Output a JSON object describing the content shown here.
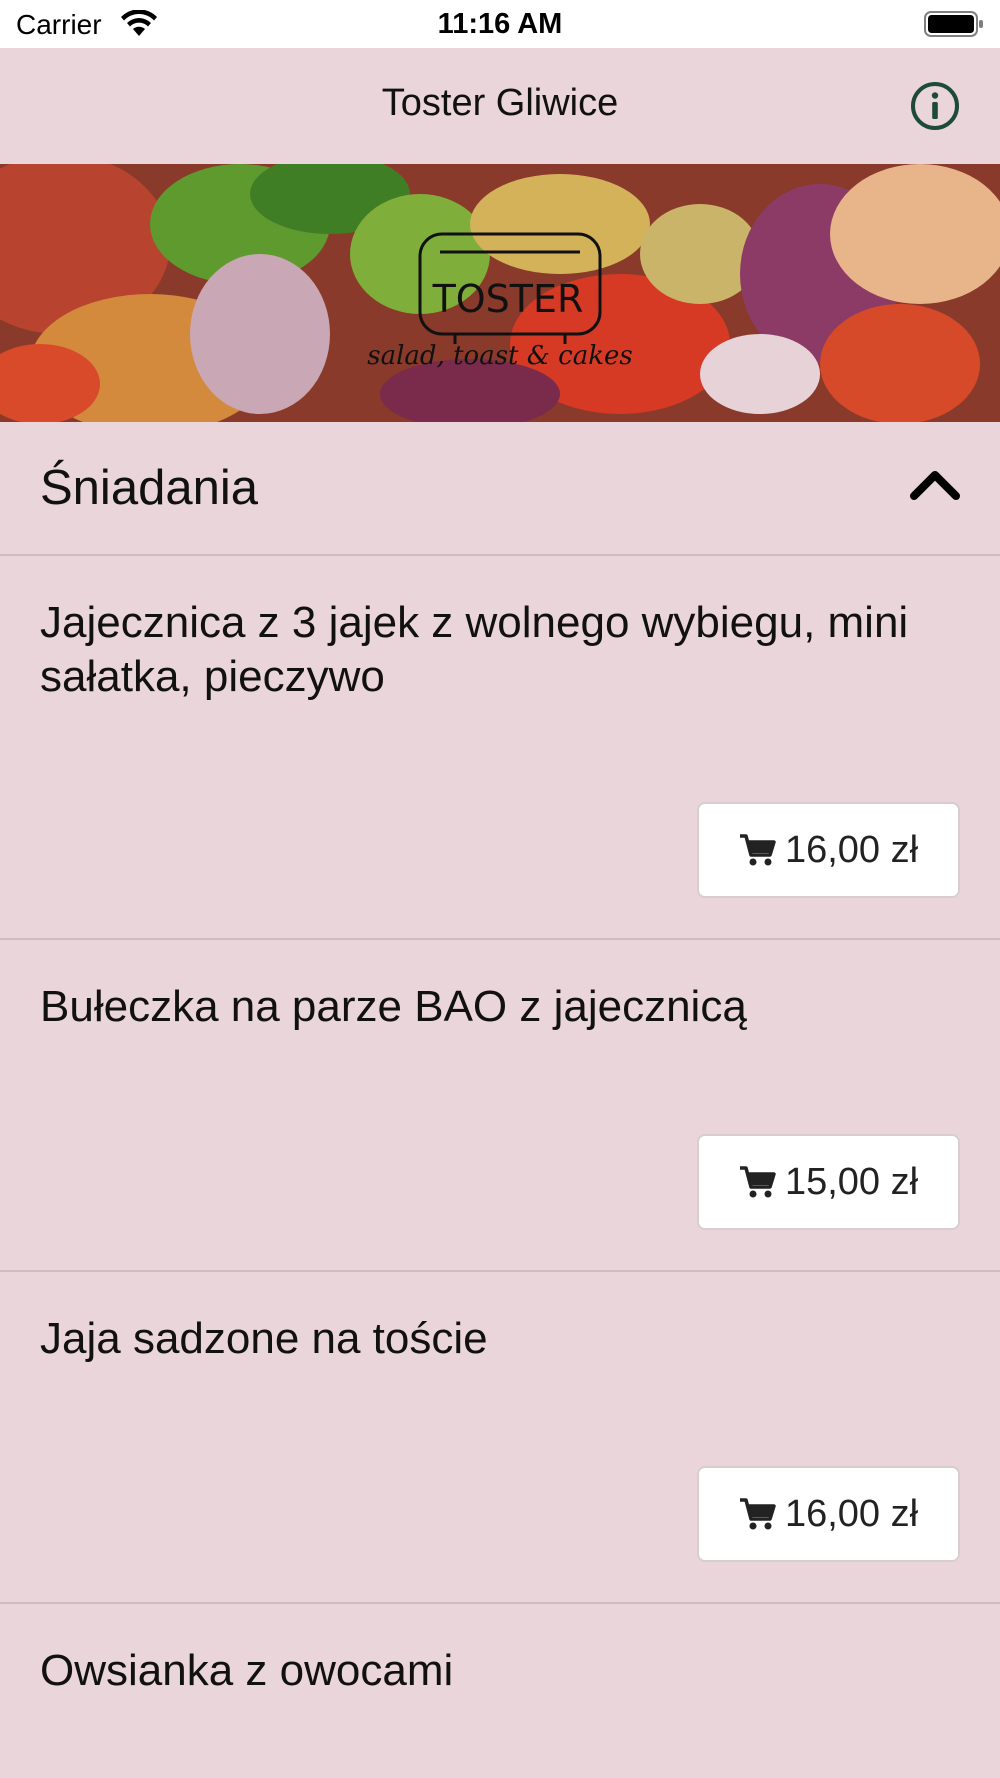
{
  "status_bar": {
    "carrier": "Carrier",
    "time": "11:16 AM"
  },
  "nav": {
    "title": "Toster Gliwice",
    "info_icon": "info-circle-icon"
  },
  "banner": {
    "logo_text": "TOSTER",
    "tagline": "salad, toast & cakes"
  },
  "section": {
    "title": "Śniadania",
    "chevron_icon": "chevron-up-icon"
  },
  "items": [
    {
      "name": "Jajecznica z 3 jajek z wolnego wybiegu, mini sałatka, pieczywo",
      "price": "16,00 zł"
    },
    {
      "name": "Bułeczka na parze BAO z jajecznicą",
      "price": "15,00 zł"
    },
    {
      "name": "Jaja sadzone na toście",
      "price": "16,00 zł"
    },
    {
      "name": "Owsianka z owocami"
    }
  ],
  "colors": {
    "background": "#e9d5da",
    "accent": "#1e4a3a"
  }
}
